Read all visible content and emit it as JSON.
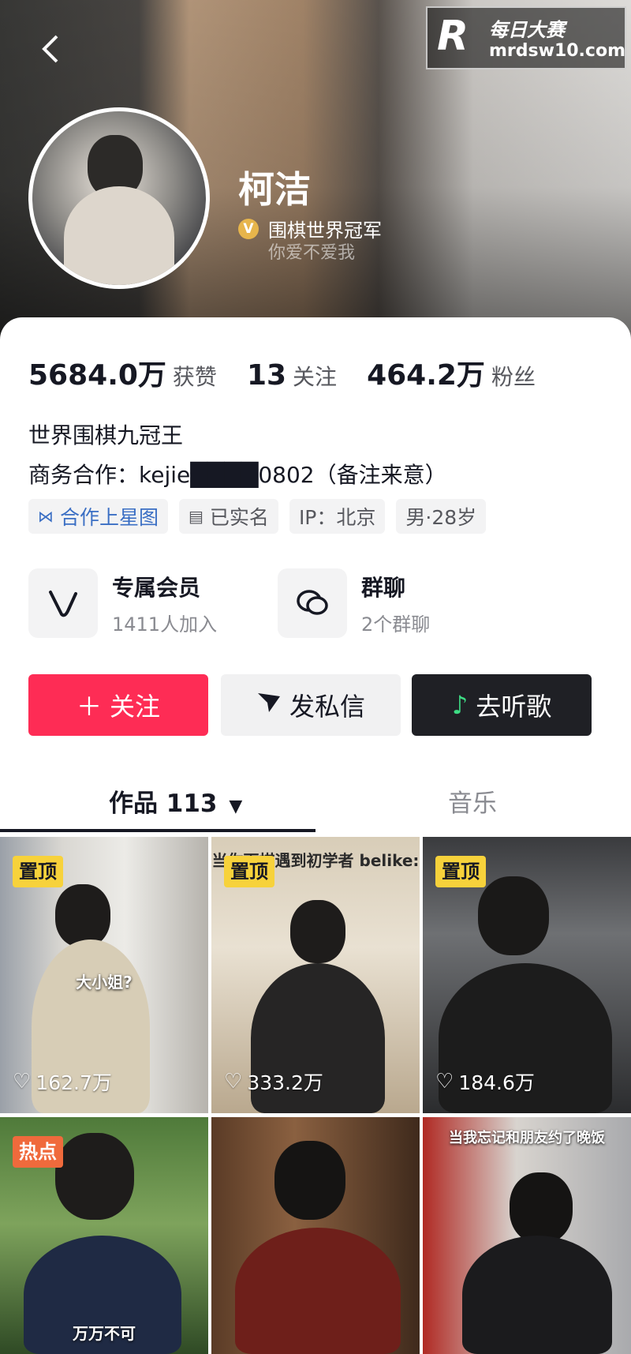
{
  "header": {
    "back_icon": "chevron-left-icon",
    "name": "柯洁",
    "verify_badge": "V",
    "verify_text": "围棋世界冠军",
    "subtitle": "你爱不爱我",
    "watermark": {
      "logo": "R",
      "cn": "每日大赛",
      "url": "mrdsw10.com"
    }
  },
  "stats": [
    {
      "value": "5684.0万",
      "label": "获赞"
    },
    {
      "value": "13",
      "label": "关注"
    },
    {
      "value": "464.2万",
      "label": "粉丝"
    }
  ],
  "bio": {
    "line1": "世界围棋九冠王",
    "line2": "商务合作：kejie████0802（备注来意）"
  },
  "tags": [
    {
      "icon": "star-map-icon",
      "label": "合作上星图"
    },
    {
      "icon": "id-card-icon",
      "label": "已实名"
    },
    {
      "label": "IP：北京"
    },
    {
      "label": "男·28岁"
    }
  ],
  "features": [
    {
      "icon": "vip-icon",
      "title": "专属会员",
      "sub": "1411人加入"
    },
    {
      "icon": "group-chat-icon",
      "title": "群聊",
      "sub": "2个群聊"
    }
  ],
  "buttons": {
    "follow": "关注",
    "message": "发私信",
    "music": "去听歌"
  },
  "tabs": {
    "works": "作品 113",
    "music": "音乐"
  },
  "videos": [
    {
      "badge": "置顶",
      "caption": "大小姐?",
      "likes": "162.7万"
    },
    {
      "badge": "置顶",
      "caption": "当你下棋遇到初学者 belike:",
      "likes": "333.2万"
    },
    {
      "badge": "置顶",
      "caption": "",
      "likes": "184.6万"
    },
    {
      "badge": "热点",
      "caption": "万万不可",
      "likes": ""
    },
    {
      "badge": "",
      "caption": "",
      "likes": ""
    },
    {
      "badge": "",
      "caption": "当我忘记和朋友约了晚饭",
      "likes": ""
    }
  ],
  "colors": {
    "accent": "#fe2c55",
    "badge_pin": "#f7d23b",
    "badge_hot": "#f06a3c"
  }
}
